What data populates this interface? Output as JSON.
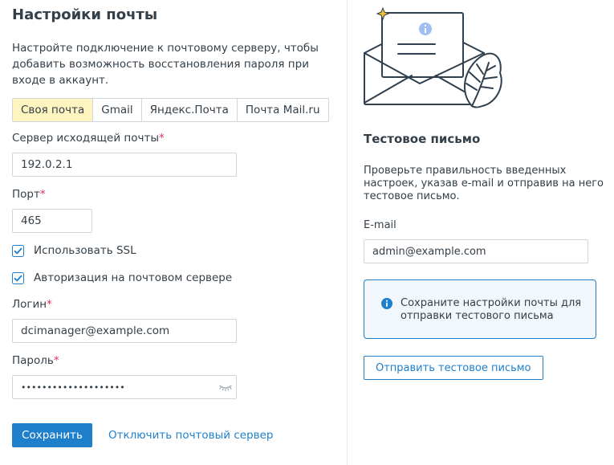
{
  "mail_settings": {
    "title": "Настройки почты",
    "description": "Настройте подключение к почтовому серверу, чтобы добавить возможность восстановления пароля при входе в аккаунт.",
    "tabs": [
      {
        "label": "Своя почта",
        "active": true
      },
      {
        "label": "Gmail",
        "active": false
      },
      {
        "label": "Яндекс.Почта",
        "active": false
      },
      {
        "label": "Почта Mail.ru",
        "active": false
      }
    ],
    "smtp_server": {
      "label": "Сервер исходящей почты",
      "value": "192.0.2.1",
      "required": true
    },
    "port": {
      "label": "Порт",
      "value": "465",
      "required": true
    },
    "use_ssl": {
      "label": "Использовать SSL",
      "checked": true
    },
    "smtp_auth": {
      "label": "Авторизация на почтовом сервере",
      "checked": true
    },
    "login": {
      "label": "Логин",
      "value": "dcimanager@example.com",
      "required": true
    },
    "password": {
      "label": "Пароль",
      "masked_value": "••••••••••••••••••••",
      "required": true
    },
    "required_mark": "*",
    "save_label": "Сохранить",
    "disable_label": "Отключить почтовый сервер"
  },
  "test_email": {
    "title": "Тестовое письмо",
    "description": "Проверьте правильность введенных настроек, указав e-mail и отправив на него тестовое письмо.",
    "email_label": "E-mail",
    "email_value": "admin@example.com",
    "info_text": "Сохраните настройки почты для отправки тестового письма",
    "send_label": "Отправить тестовое письмо"
  },
  "colors": {
    "accent": "#1e7fcb",
    "active_tab": "#fdf4c0",
    "required": "#e0305a",
    "info_bg": "#f1f7fc",
    "text": "#343f48"
  },
  "icons": [
    "envelope-illustration",
    "info-icon",
    "checkbox-checked-icon",
    "eye-hidden-icon"
  ]
}
